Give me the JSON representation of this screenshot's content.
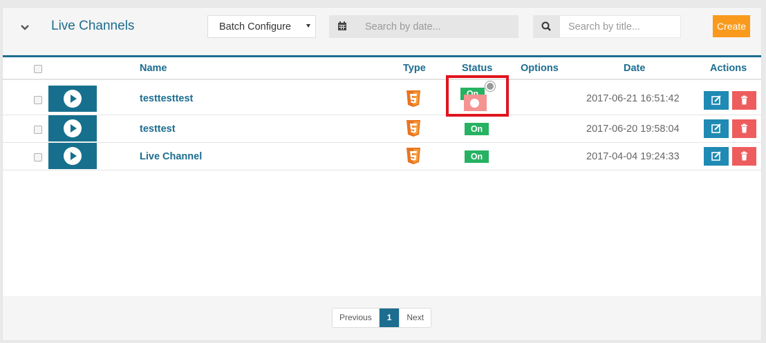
{
  "header": {
    "title": "Live Channels",
    "batch_label": "Batch Configure",
    "date_placeholder": "Search by date...",
    "title_placeholder": "Search by title...",
    "create_label": "Create"
  },
  "columns": [
    "Name",
    "Type",
    "Status",
    "Options",
    "Date",
    "Actions"
  ],
  "rows": [
    {
      "name": "testtesttest",
      "status": "On",
      "date": "2017-06-21 16:51:42"
    },
    {
      "name": "testtest",
      "status": "On",
      "date": "2017-06-20 19:58:04"
    },
    {
      "name": "Live Channel",
      "status": "On",
      "date": "2017-04-04 19:24:33"
    }
  ],
  "pagination": {
    "previous": "Previous",
    "current": "1",
    "next": "Next"
  },
  "icons": [
    "chevron-down-icon",
    "calendar-icon",
    "search-icon",
    "play-icon",
    "html5-icon",
    "edit-icon",
    "trash-icon"
  ],
  "colors": {
    "brand": "#1c6d8f",
    "create": "#f99a1c",
    "on": "#26b262",
    "delete": "#ee5d5d",
    "edit": "#1f8ab3",
    "highlight": "#e0141e"
  }
}
